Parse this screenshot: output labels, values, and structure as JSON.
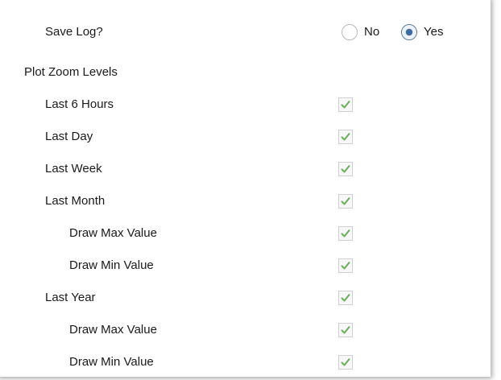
{
  "save_log": {
    "label": "Save Log?",
    "options": [
      {
        "label": "No",
        "selected": false
      },
      {
        "label": "Yes",
        "selected": true
      }
    ]
  },
  "plot_zoom": {
    "heading": "Plot Zoom Levels",
    "items": [
      {
        "label": "Last 6 Hours",
        "checked": true
      },
      {
        "label": "Last Day",
        "checked": true
      },
      {
        "label": "Last Week",
        "checked": true
      },
      {
        "label": "Last Month",
        "checked": true
      },
      {
        "label": "Draw Max Value",
        "checked": true
      },
      {
        "label": "Draw Min Value",
        "checked": true
      },
      {
        "label": "Last Year",
        "checked": true
      },
      {
        "label": "Draw Max Value",
        "checked": true
      },
      {
        "label": "Draw Min Value",
        "checked": true
      }
    ]
  },
  "colors": {
    "checkmark": "#6db35f",
    "radio_dot": "#3c6c9e"
  },
  "icons": {
    "checkmark": "check-icon"
  }
}
